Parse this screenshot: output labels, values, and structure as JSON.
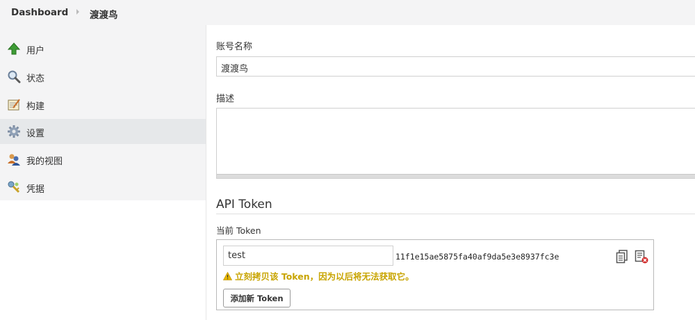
{
  "breadcrumb": {
    "root": "Dashboard",
    "current": "渡渡鸟"
  },
  "sidebar": {
    "items": [
      {
        "label": "用户",
        "icon": "up-arrow-icon"
      },
      {
        "label": "状态",
        "icon": "magnifier-icon"
      },
      {
        "label": "构建",
        "icon": "notepad-icon"
      },
      {
        "label": "设置",
        "icon": "gear-icon",
        "active": true
      },
      {
        "label": "我的视图",
        "icon": "people-icon"
      },
      {
        "label": "凭据",
        "icon": "key-icon"
      }
    ]
  },
  "form": {
    "account_label": "账号名称",
    "account_value": "渡渡鸟",
    "description_label": "描述",
    "description_value": ""
  },
  "api_token": {
    "title": "API Token",
    "current_label": "当前 Token",
    "token_name": "test",
    "token_value": "11f1e15ae5875fa40af9da5e3e8937fc3e",
    "warning": "立刻拷贝该 Token，因为以后将无法获取它。",
    "add_button": "添加新 Token"
  },
  "colors": {
    "warning": "#c8a400",
    "sidebar_bg": "#f4f4f5",
    "active_bg": "#e6e8ea"
  }
}
